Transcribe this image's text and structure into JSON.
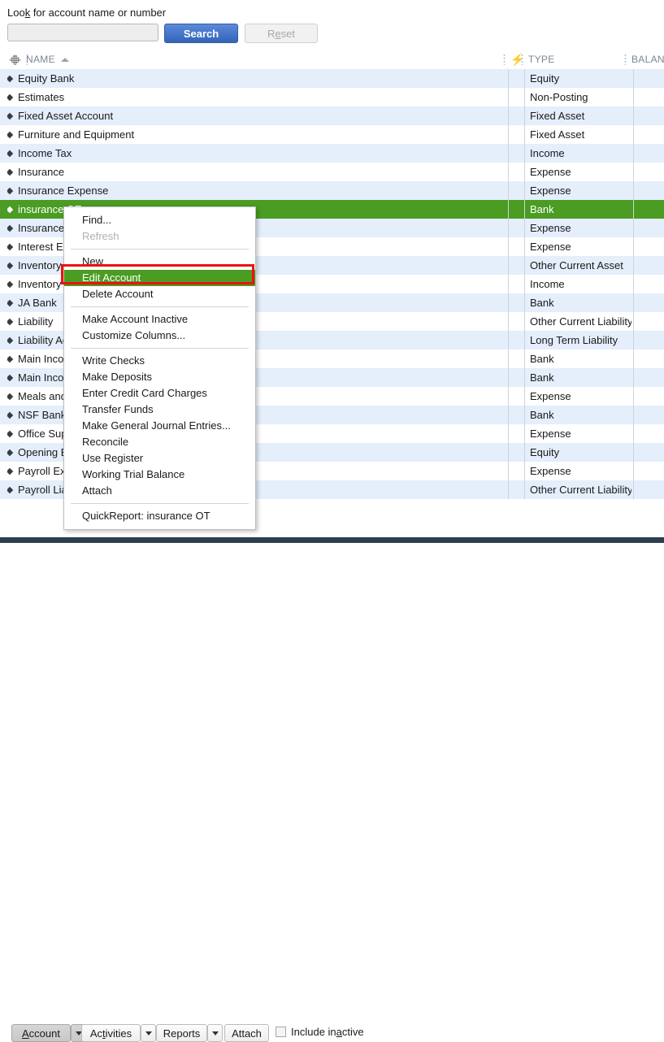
{
  "search": {
    "label_pre": "Loo",
    "label_accel": "k",
    "label_post": " for account name or number",
    "label_full": "Look for account name or number",
    "input_value": "",
    "input_placeholder": "",
    "search_button": "Search",
    "reset_button": "Reset"
  },
  "columns": {
    "name": "NAME",
    "flag_icon": "lightning-bolt-icon",
    "type": "TYPE",
    "balance": "BALAN",
    "sort_indicator": "ascending"
  },
  "accounts": [
    {
      "name": "Equity Bank",
      "type": "Equity",
      "balance": ""
    },
    {
      "name": "Estimates",
      "type": "Non-Posting",
      "balance": ""
    },
    {
      "name": "Fixed Asset Account",
      "type": "Fixed Asset",
      "balance": ""
    },
    {
      "name": "Furniture and Equipment",
      "type": "Fixed Asset",
      "balance": ""
    },
    {
      "name": "Income Tax",
      "type": "Income",
      "balance": ""
    },
    {
      "name": "Insurance",
      "type": "Expense",
      "balance": ""
    },
    {
      "name": "Insurance Expense",
      "type": "Expense",
      "balance": ""
    },
    {
      "name": "insurance OT",
      "type": "Bank",
      "balance": ""
    },
    {
      "name": "Insurance:I",
      "type": "Expense",
      "balance": ""
    },
    {
      "name": "Interest Exp",
      "type": "Expense",
      "balance": ""
    },
    {
      "name": "Inventory A",
      "type": "Other Current Asset",
      "balance": ""
    },
    {
      "name": "Inventory In",
      "type": "Income",
      "balance": ""
    },
    {
      "name": "JA Bank",
      "type": "Bank",
      "balance": ""
    },
    {
      "name": "Liability",
      "type": "Other Current Liability",
      "balance": ""
    },
    {
      "name": "Liability Acc",
      "type": "Long Term Liability",
      "balance": ""
    },
    {
      "name": "Main Incom",
      "type": "Bank",
      "balance": ""
    },
    {
      "name": "Main Incom",
      "type": "Bank",
      "balance": ""
    },
    {
      "name": "Meals and",
      "type": "Expense",
      "balance": ""
    },
    {
      "name": "NSF Bank",
      "type": "Bank",
      "balance": ""
    },
    {
      "name": "Office Supp",
      "type": "Expense",
      "balance": ""
    },
    {
      "name": "Opening Ba",
      "type": "Equity",
      "balance": ""
    },
    {
      "name": "Payroll Exp",
      "type": "Expense",
      "balance": ""
    },
    {
      "name": "Payroll Liab",
      "type": "Other Current Liability",
      "balance": ""
    }
  ],
  "selected_account": "insurance OT",
  "context_menu": {
    "items": [
      {
        "label": "Find...",
        "state": "normal"
      },
      {
        "label": "Refresh",
        "state": "disabled"
      },
      {
        "label": "-sep-",
        "state": "separator"
      },
      {
        "label": "New",
        "state": "normal"
      },
      {
        "label": "Edit Account",
        "state": "highlighted"
      },
      {
        "label": "Delete Account",
        "state": "normal"
      },
      {
        "label": "-sep-",
        "state": "separator"
      },
      {
        "label": "Make Account Inactive",
        "state": "normal"
      },
      {
        "label": "Customize Columns...",
        "state": "normal"
      },
      {
        "label": "-sep-",
        "state": "separator"
      },
      {
        "label": "Write Checks",
        "state": "normal"
      },
      {
        "label": "Make Deposits",
        "state": "normal"
      },
      {
        "label": "Enter Credit Card Charges",
        "state": "normal"
      },
      {
        "label": "Transfer Funds",
        "state": "normal"
      },
      {
        "label": "Make General Journal Entries...",
        "state": "normal"
      },
      {
        "label": "Reconcile",
        "state": "normal"
      },
      {
        "label": "Use Register",
        "state": "normal"
      },
      {
        "label": "Working Trial Balance",
        "state": "normal"
      },
      {
        "label": "Attach",
        "state": "normal"
      },
      {
        "label": "-sep-",
        "state": "separator"
      },
      {
        "label": "QuickReport: insurance OT",
        "state": "normal"
      }
    ]
  },
  "toolbar": {
    "account_button": "Account",
    "activities_button": "Activities",
    "reports_button": "Reports",
    "attach_button": "Attach",
    "include_inactive_label": "Include inactive",
    "include_inactive_checked": false
  },
  "colors": {
    "selection_green": "#4a9c22",
    "row_alt_blue": "#e5eefb",
    "search_blue": "#3464b8",
    "annotation_red": "#ee1111",
    "bottom_strip": "#2c3e50"
  }
}
